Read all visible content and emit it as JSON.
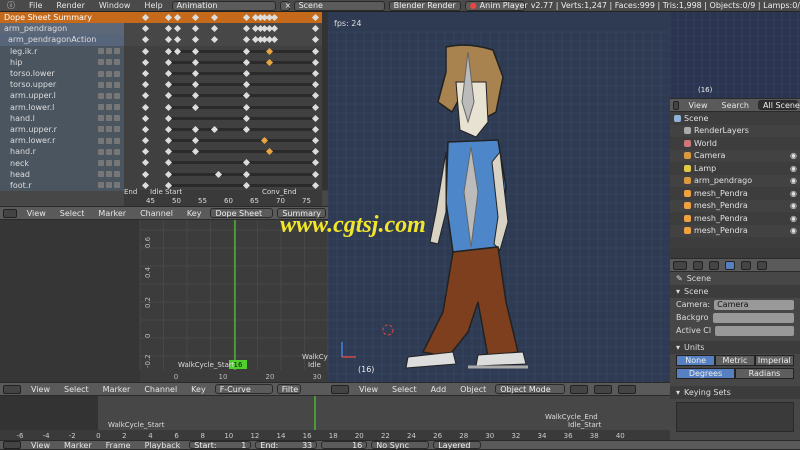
{
  "topbar": {
    "menus": [
      "File",
      "Render",
      "Window",
      "Help"
    ],
    "screen_layout": "Animation",
    "scene": "Scene",
    "render_engine": "Blender Render",
    "anim_player": "Anim Player",
    "stats": "v2.77 | Verts:1,247 | Faces:999 | Tris:1,998 | Objects:0/9 | Lamps:0/"
  },
  "dopesheet": {
    "rows": [
      {
        "label": "Dope Sheet Summary",
        "kind": "sum",
        "keys": [
          3,
          8,
          10,
          14,
          18,
          25,
          27,
          28,
          29,
          30,
          31,
          40
        ]
      },
      {
        "label": "arm_pendragon",
        "kind": "obj",
        "keys": [
          3,
          8,
          10,
          14,
          18,
          25,
          27,
          28,
          29,
          30,
          31,
          40
        ]
      },
      {
        "label": "arm_pendragonAction",
        "kind": "act",
        "keys": [
          3,
          8,
          10,
          14,
          18,
          25,
          27,
          28,
          29,
          30,
          31,
          40
        ]
      },
      {
        "label": "leg.ik.r",
        "kind": "ch",
        "keys": [
          3,
          8,
          10,
          14,
          25,
          30,
          40
        ]
      },
      {
        "label": "hip",
        "kind": "ch",
        "keys": [
          3,
          8,
          14,
          25,
          30,
          40
        ]
      },
      {
        "label": "torso.lower",
        "kind": "ch",
        "keys": [
          3,
          8,
          14,
          25,
          40
        ]
      },
      {
        "label": "torso.upper",
        "kind": "ch",
        "keys": [
          3,
          8,
          14,
          25,
          40
        ]
      },
      {
        "label": "arm.upper.l",
        "kind": "ch",
        "keys": [
          3,
          8,
          14,
          25,
          40
        ]
      },
      {
        "label": "arm.lower.l",
        "kind": "ch",
        "keys": [
          3,
          8,
          14,
          25,
          40
        ]
      },
      {
        "label": "hand.l",
        "kind": "ch",
        "keys": [
          3,
          8,
          25,
          40
        ]
      },
      {
        "label": "arm.upper.r",
        "kind": "ch",
        "keys": [
          3,
          8,
          14,
          18,
          25,
          40
        ]
      },
      {
        "label": "arm.lower.r",
        "kind": "ch",
        "keys": [
          3,
          8,
          14,
          29,
          40
        ]
      },
      {
        "label": "hand.r",
        "kind": "ch",
        "keys": [
          3,
          8,
          14,
          30,
          40
        ]
      },
      {
        "label": "neck",
        "kind": "ch",
        "keys": [
          3,
          8,
          25,
          40
        ]
      },
      {
        "label": "head",
        "kind": "ch",
        "keys": [
          3,
          8,
          19,
          25,
          40
        ]
      },
      {
        "label": "foot.r",
        "kind": "ch",
        "keys": [
          3,
          8,
          25,
          40
        ]
      }
    ],
    "orange_keys": [
      27,
      28,
      29,
      30
    ],
    "markers": {
      "end": "End",
      "idle_start": "Idle Start",
      "conv_end": "Conv_End"
    },
    "ticks": [
      "45",
      "50",
      "55",
      "60",
      "65",
      "70",
      "75"
    ],
    "header": {
      "items": [
        "View",
        "Select",
        "Marker",
        "Channel",
        "Key"
      ],
      "mode": "Dope Sheet",
      "summary": "Summary"
    }
  },
  "fcurve": {
    "yticks": [
      "0.6",
      "0.4",
      "0.2",
      "0",
      "-0.2"
    ],
    "xticks": [
      "0",
      "10",
      "20",
      "30"
    ],
    "current_frame": "16",
    "markers": {
      "walk_start": "WalkCycle_Start",
      "walk_end": "WalkCycle_End",
      "idle": "Idle"
    },
    "header": {
      "items": [
        "View",
        "Select",
        "Marker",
        "Channel",
        "Key"
      ],
      "mode": "F-Curve",
      "filter": "Filte"
    }
  },
  "viewport": {
    "fps": "fps: 24",
    "frame_label": "(16)",
    "watermark": "www.cgtsj.com",
    "header": {
      "items": [
        "View",
        "Select",
        "Add",
        "Object"
      ],
      "mode": "Object Mode"
    }
  },
  "mini_view": {
    "frame_label": "(16)"
  },
  "outliner": {
    "header": {
      "view": "View",
      "search": "Search",
      "all": "All Scenes"
    },
    "items": [
      "Scene",
      "RenderLayers",
      "World",
      "Camera",
      "Lamp",
      "arm_pendrago",
      "mesh_Pendra",
      "mesh_Pendra",
      "mesh_Pendra",
      "mesh_Pendra"
    ]
  },
  "properties": {
    "breadcrumb": "Scene",
    "scene_panel": "Scene",
    "camera_label": "Camera:",
    "camera_value": "Camera",
    "background_label": "Backgro",
    "active_clip_label": "Active Cl",
    "units_panel": "Units",
    "unit_buttons": [
      "None",
      "Metric",
      "Imperial"
    ],
    "rotation_buttons": [
      "Degrees",
      "Radians"
    ],
    "keying_panel": "Keying Sets"
  },
  "timeline": {
    "ticks": [
      "-6",
      "-4",
      "-2",
      "0",
      "2",
      "4",
      "6",
      "8",
      "10",
      "12",
      "14",
      "16",
      "18",
      "20",
      "22",
      "24",
      "26",
      "28",
      "30",
      "32",
      "34",
      "36",
      "38",
      "40"
    ],
    "markers": {
      "walk_start": "WalkCycle_Start",
      "walk_end": "WalkCycle_End",
      "idle_start": "Idle_Start"
    },
    "header": {
      "items": [
        "View",
        "Marker",
        "Frame",
        "Playback"
      ],
      "start": "Start:",
      "start_value": "1",
      "end": "End:",
      "end_value": "33",
      "current": "16",
      "sync": "No Sync",
      "layered": "Layered"
    }
  },
  "colors": {
    "summary": "#c56a1b",
    "playhead": "#4fd02b",
    "viewport_bg": "#2e3b52",
    "selected_blue": "#5680c2"
  }
}
